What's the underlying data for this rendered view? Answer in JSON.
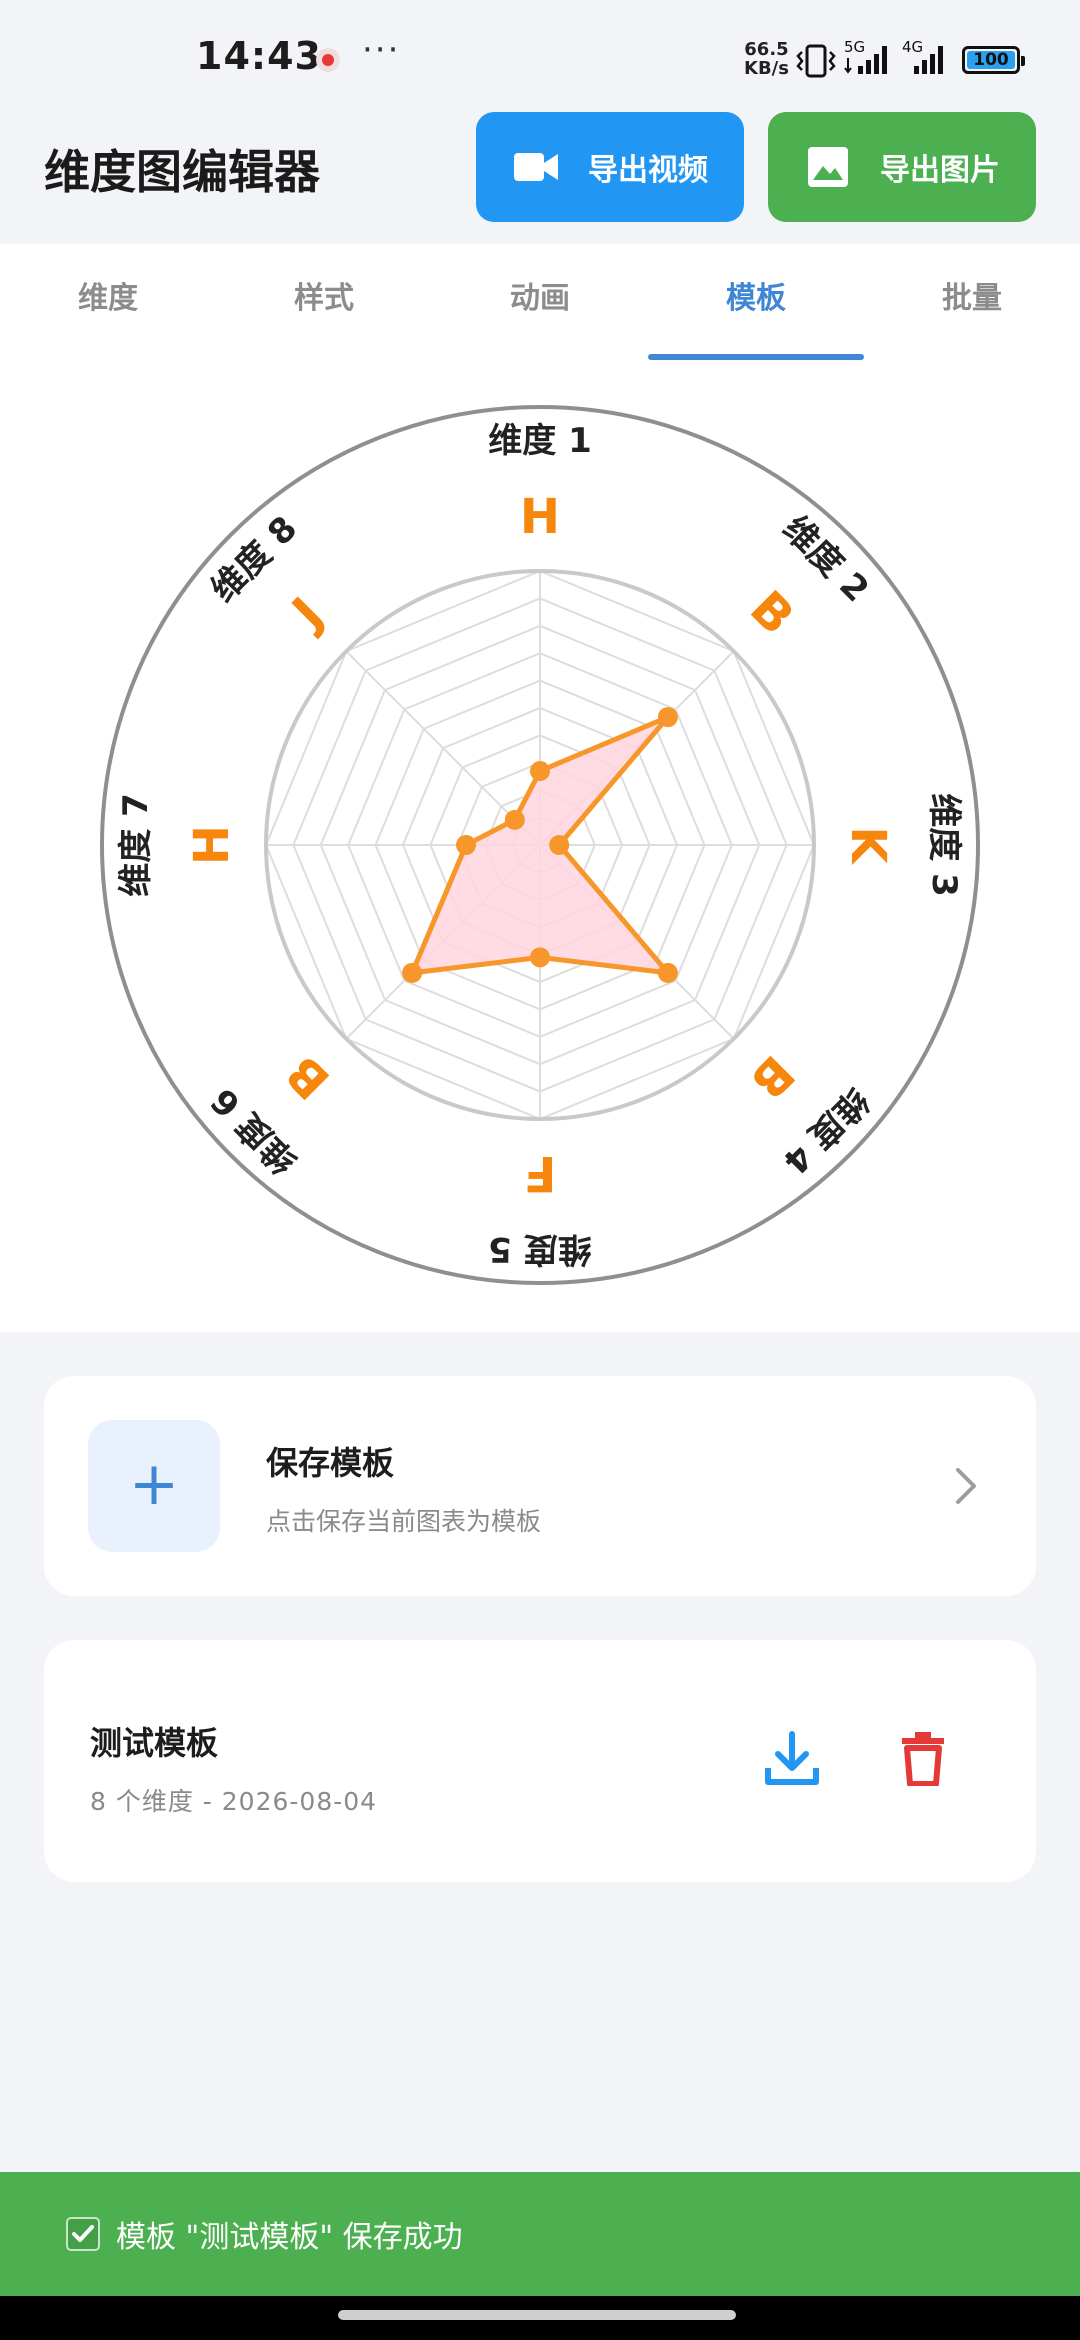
{
  "status_bar": {
    "time": "14:43",
    "more": "···",
    "net_speed_value": "66.5",
    "net_speed_unit": "KB/s",
    "sig1_label": "5G",
    "sig2_label": "4G",
    "battery": "100"
  },
  "header": {
    "title": "维度图编辑器",
    "export_video_label": "导出视频",
    "export_image_label": "导出图片",
    "export_video_color": "#2196f3",
    "export_image_color": "#4caf50"
  },
  "tabs": [
    {
      "label": "维度"
    },
    {
      "label": "样式"
    },
    {
      "label": "动画"
    },
    {
      "label": "模板",
      "active": true
    },
    {
      "label": "批量"
    }
  ],
  "chart_data": {
    "type": "radar",
    "axes": [
      "维度 1",
      "维度 2",
      "维度 3",
      "维度 4",
      "维度 5",
      "维度 6",
      "维度 7",
      "维度 8"
    ],
    "grades": [
      "H",
      "B",
      "K",
      "B",
      "F",
      "B",
      "H",
      "J"
    ],
    "values": [
      0.27,
      0.66,
      0.07,
      0.66,
      0.41,
      0.66,
      0.27,
      0.13
    ],
    "range": [
      0,
      1
    ],
    "levels": 10,
    "line_color": "#f7962a",
    "fill_color": "#ffd6de",
    "grade_color": "#f7870c"
  },
  "save_card": {
    "title": "保存模板",
    "subtitle": "点击保存当前图表为模板",
    "icon": "plus-icon"
  },
  "template_card": {
    "name": "测试模板",
    "meta": "8 个维度 - 2026-08-04",
    "load_icon": "download-icon",
    "delete_icon": "trash-icon"
  },
  "snackbar": {
    "message": "模板 \"测试模板\" 保存成功"
  }
}
